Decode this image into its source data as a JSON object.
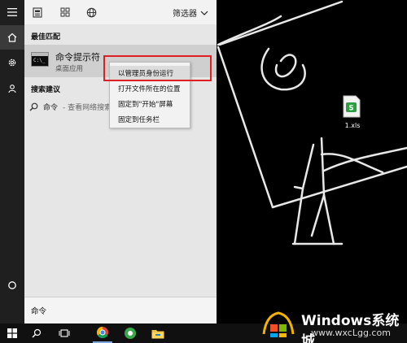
{
  "panel": {
    "filter_label": "筛选器",
    "best_match_title": "最佳匹配",
    "best_match": {
      "name": "命令提示符",
      "subtitle": "桌面应用"
    },
    "search_suggestions_title": "搜索建议",
    "suggestion": {
      "term": "命令",
      "hint": "- 查看网络搜索结果"
    },
    "search_query": "命令"
  },
  "context_menu": {
    "items": [
      "以管理员身份运行",
      "打开文件所在的位置",
      "固定到\"开始\"屏幕",
      "固定到任务栏"
    ]
  },
  "desktop": {
    "file_name": "1.xls"
  },
  "watermark": {
    "title": "Windows系统城",
    "url": "www.wxcLgg.com"
  },
  "colors": {
    "highlight_frame": "#e02020",
    "panel_bg": "#e6e6e6",
    "taskbar_bg": "#101010"
  },
  "icons": [
    "menu-icon",
    "home-icon",
    "settings-icon",
    "people-icon",
    "power-icon",
    "document-icon",
    "grid-icon",
    "globe-icon",
    "chevron-down-icon",
    "cmd-icon",
    "search-icon",
    "windows-logo-icon",
    "task-view-icon",
    "chrome-icon",
    "security-app-icon",
    "file-explorer-icon",
    "excel-file-icon"
  ]
}
